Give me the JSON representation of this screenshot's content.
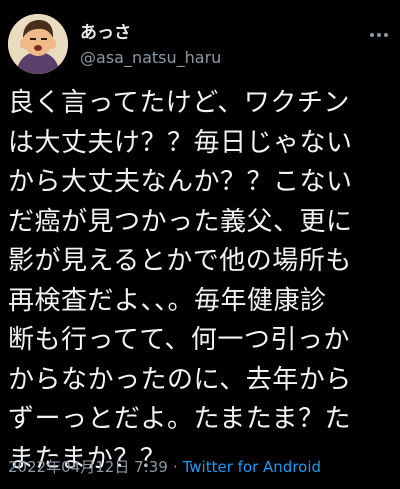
{
  "user": {
    "display_name": "あっさ",
    "handle": "@asa_natsu_haru",
    "avatar_icon": "avatar-icon"
  },
  "tweet": {
    "lines": [
      "良く言ってたけど、ワクチン",
      "は大丈夫け？？毎日じゃない",
      "から大丈夫なんか？？こない",
      "だ癌が見つかった義父、更に",
      "影が見えるとかで他の場所も",
      "再検査だよ、、。毎年健康診",
      "断も行ってて、何一つ引っか",
      "からなかったのに、去年から",
      "ずーっとだよ。たまたま？た",
      "またまか？？"
    ]
  },
  "meta": {
    "timestamp": "2022年04月12日 7:39",
    "separator": "·",
    "source": "Twitter for Android"
  },
  "colors": {
    "background": "#000000",
    "text": "#e7e9ea",
    "secondary": "#8b98a5",
    "link": "#1d9bf0"
  },
  "icons": {
    "more": "more-horizontal-icon"
  }
}
